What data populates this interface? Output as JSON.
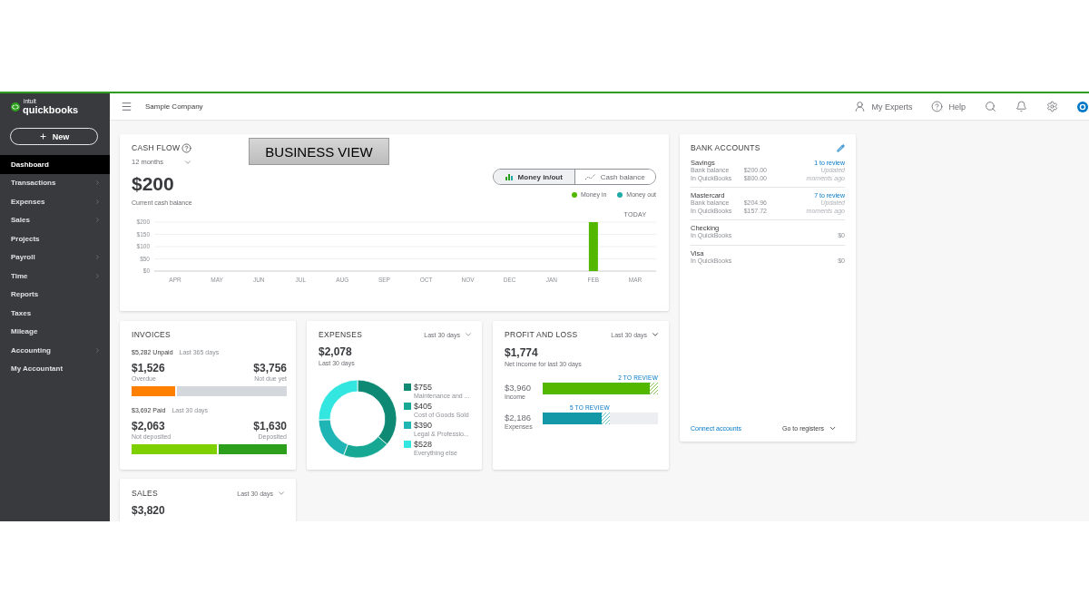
{
  "sidebar": {
    "logo": {
      "tagline": "intuit",
      "name": "quickbooks"
    },
    "new_button": {
      "label": "New"
    },
    "items": [
      {
        "label": "Dashboard",
        "selected": true,
        "has_submenu": false
      },
      {
        "label": "Transactions",
        "selected": false,
        "has_submenu": true
      },
      {
        "label": "Expenses",
        "selected": false,
        "has_submenu": true
      },
      {
        "label": "Sales",
        "selected": false,
        "has_submenu": true
      },
      {
        "label": "Projects",
        "selected": false,
        "has_submenu": false
      },
      {
        "label": "Payroll",
        "selected": false,
        "has_submenu": true
      },
      {
        "label": "Time",
        "selected": false,
        "has_submenu": true
      },
      {
        "label": "Reports",
        "selected": false,
        "has_submenu": false
      },
      {
        "label": "Taxes",
        "selected": false,
        "has_submenu": false
      },
      {
        "label": "Mileage",
        "selected": false,
        "has_submenu": false
      },
      {
        "label": "Accounting",
        "selected": false,
        "has_submenu": true
      },
      {
        "label": "My Accountant",
        "selected": false,
        "has_submenu": false
      }
    ]
  },
  "header": {
    "company": "Sample Company",
    "actions": [
      {
        "kind": "experts",
        "label": "My Experts"
      },
      {
        "kind": "help",
        "label": "Help"
      },
      {
        "kind": "search"
      },
      {
        "kind": "notifications"
      },
      {
        "kind": "settings"
      },
      {
        "kind": "profile"
      }
    ]
  },
  "cash_flow": {
    "title": "CASH FLOW",
    "period": "12 months",
    "amount": "$200",
    "caption": "Current cash balance",
    "view_toggle": [
      {
        "label": "Money in/out",
        "kind": "bars",
        "selected": true
      },
      {
        "label": "Cash balance",
        "kind": "line",
        "selected": false
      }
    ],
    "chart_data": {
      "type": "bar",
      "categories": [
        "APR",
        "MAY",
        "JUN",
        "JUL",
        "AUG",
        "SEP",
        "OCT",
        "NOV",
        "DEC",
        "JAN",
        "FEB",
        "MAR"
      ],
      "series": [
        {
          "name": "Money in",
          "color": "#53b700",
          "values": [
            0,
            0,
            0,
            0,
            0,
            0,
            0,
            0,
            0,
            0,
            200,
            0
          ]
        },
        {
          "name": "Money out",
          "color": "#21aba6",
          "values": [
            0,
            0,
            0,
            0,
            0,
            0,
            0,
            0,
            0,
            0,
            0,
            0
          ]
        }
      ],
      "ylim": [
        0,
        200
      ],
      "yticks": [
        {
          "value": 0,
          "label": "$0"
        },
        {
          "value": 50,
          "label": "$50"
        },
        {
          "value": 100,
          "label": "$100"
        },
        {
          "value": 150,
          "label": "$150"
        },
        {
          "value": 200,
          "label": "$200"
        }
      ],
      "grid": true,
      "annotations": [
        "TODAY"
      ]
    }
  },
  "annotation": {
    "text": "BUSINESS VIEW"
  },
  "invoices": {
    "title": "INVOICES",
    "sections": [
      {
        "kind": "unpaid",
        "total": "$5,282 Unpaid",
        "period": "Last 365 days",
        "left": {
          "amount": "$1,526",
          "label": "Overdue"
        },
        "right": {
          "amount": "$3,756",
          "label": "Not due yet"
        },
        "level": 0.29
      },
      {
        "kind": "paid",
        "total": "$3,692 Paid",
        "period": "Last 30 days",
        "left": {
          "amount": "$2,063",
          "label": "Not deposited"
        },
        "right": {
          "amount": "$1,630",
          "label": "Deposited"
        },
        "level": 0.56
      }
    ]
  },
  "expenses": {
    "title": "EXPENSES",
    "period": "Last 30 days",
    "amount": "$2,078",
    "caption": "Last 30 days",
    "legend": [
      {
        "amount": "$755",
        "color": "#0e8a74"
      },
      {
        "amount": "$405",
        "color": "#17a894"
      },
      {
        "amount": "$390",
        "color": "#1fb5b5"
      },
      {
        "amount": "$528",
        "color": "#33e6df"
      }
    ],
    "chart_data": {
      "type": "donut",
      "categories": [
        "Maintenance and ...",
        "Cost of Goods Sold",
        "Legal & Professio...",
        "Everything else"
      ],
      "values": [
        36.33,
        19.49,
        18.77,
        25.41
      ]
    }
  },
  "profit_and_loss": {
    "title": "PROFIT AND LOSS",
    "period": "Last 30 days",
    "amount": "$1,774",
    "caption": "Net income for last 30 days",
    "bars": [
      {
        "kind": "income",
        "review": "2 TO REVIEW",
        "amount": "$3,960",
        "label": "Income",
        "level": 0.93
      },
      {
        "kind": "expenses",
        "review": "5 TO REVIEW",
        "amount": "$2,186",
        "label": "Expenses",
        "level": 0.51
      }
    ]
  },
  "sales": {
    "title": "SALES",
    "period": "Last 30 days",
    "amount": "$3,820"
  },
  "bank_accounts": {
    "title": "BANK ACCOUNTS",
    "accounts": [
      {
        "name": "Savings",
        "review": "1 to review",
        "rows": [
          {
            "label": "Bank balance",
            "amount": "$200.00",
            "note": "Updated"
          },
          {
            "label": "In QuickBooks",
            "amount": "$800.00",
            "note": "moments ago"
          }
        ]
      },
      {
        "name": "Mastercard",
        "review": "7 to review",
        "rows": [
          {
            "label": "Bank balance",
            "amount": "$204.96",
            "note": "Updated"
          },
          {
            "label": "In QuickBooks",
            "amount": "$157.72",
            "note": "moments ago"
          }
        ]
      },
      {
        "name": "Checking",
        "rows": [
          {
            "label": "In QuickBooks",
            "amount": "$0"
          }
        ]
      },
      {
        "name": "Visa",
        "rows": [
          {
            "label": "In QuickBooks",
            "amount": "$0"
          }
        ]
      }
    ],
    "footer": {
      "link": "Connect accounts",
      "menu": "Go to registers"
    }
  }
}
